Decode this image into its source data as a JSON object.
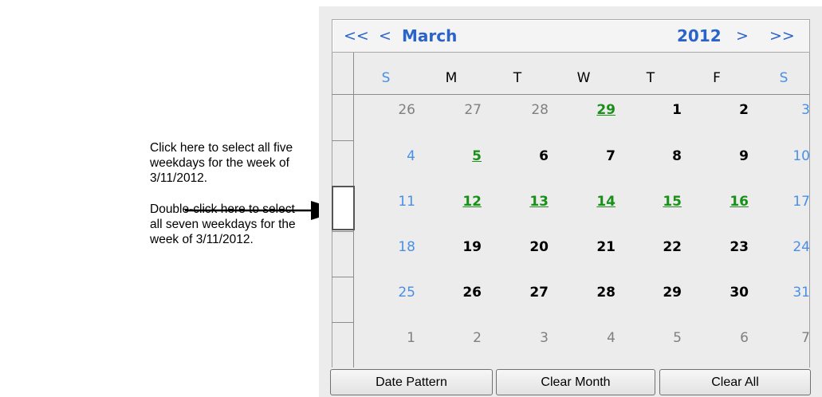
{
  "callouts": {
    "single_click": "Click here to select all five weekdays for the week of 3/11/2012.",
    "double_click": "Double-click here to select all seven weekdays for the week of 3/11/2012."
  },
  "calendar": {
    "nav": {
      "prev_year": "<<",
      "prev_month": "<",
      "month": "March",
      "year": "2012",
      "next_month": ">",
      "next_year": ">>"
    },
    "days_of_week": [
      "S",
      "M",
      "T",
      "W",
      "T",
      "F",
      "S"
    ],
    "selected_week_row": 3,
    "weeks": [
      [
        {
          "d": "26",
          "s": "muted"
        },
        {
          "d": "27",
          "s": "muted"
        },
        {
          "d": "28",
          "s": "muted"
        },
        {
          "d": "29",
          "s": "green"
        },
        {
          "d": "1",
          "s": "normal"
        },
        {
          "d": "2",
          "s": "normal"
        },
        {
          "d": "3",
          "s": "weekend"
        }
      ],
      [
        {
          "d": "4",
          "s": "weekend"
        },
        {
          "d": "5",
          "s": "green"
        },
        {
          "d": "6",
          "s": "normal"
        },
        {
          "d": "7",
          "s": "normal"
        },
        {
          "d": "8",
          "s": "normal"
        },
        {
          "d": "9",
          "s": "normal"
        },
        {
          "d": "10",
          "s": "weekend"
        }
      ],
      [
        {
          "d": "11",
          "s": "weekend"
        },
        {
          "d": "12",
          "s": "green"
        },
        {
          "d": "13",
          "s": "green"
        },
        {
          "d": "14",
          "s": "green"
        },
        {
          "d": "15",
          "s": "green"
        },
        {
          "d": "16",
          "s": "green"
        },
        {
          "d": "17",
          "s": "weekend"
        }
      ],
      [
        {
          "d": "18",
          "s": "weekend"
        },
        {
          "d": "19",
          "s": "normal"
        },
        {
          "d": "20",
          "s": "normal"
        },
        {
          "d": "21",
          "s": "normal"
        },
        {
          "d": "22",
          "s": "normal"
        },
        {
          "d": "23",
          "s": "normal"
        },
        {
          "d": "24",
          "s": "weekend"
        }
      ],
      [
        {
          "d": "25",
          "s": "weekend"
        },
        {
          "d": "26",
          "s": "normal"
        },
        {
          "d": "27",
          "s": "normal"
        },
        {
          "d": "28",
          "s": "normal"
        },
        {
          "d": "29",
          "s": "normal"
        },
        {
          "d": "30",
          "s": "normal"
        },
        {
          "d": "31",
          "s": "weekend"
        }
      ],
      [
        {
          "d": "1",
          "s": "muted"
        },
        {
          "d": "2",
          "s": "muted"
        },
        {
          "d": "3",
          "s": "muted"
        },
        {
          "d": "4",
          "s": "muted"
        },
        {
          "d": "5",
          "s": "muted"
        },
        {
          "d": "6",
          "s": "muted"
        },
        {
          "d": "7",
          "s": "muted"
        }
      ]
    ],
    "buttons": {
      "date_pattern": "Date Pattern",
      "clear_month": "Clear Month",
      "clear_all": "Clear All"
    }
  },
  "colors": {
    "weekend_blue": "#4a8fe6",
    "selected_green": "#1a8f1a",
    "nav_blue": "#2a63c9",
    "muted_gray": "#808080"
  }
}
